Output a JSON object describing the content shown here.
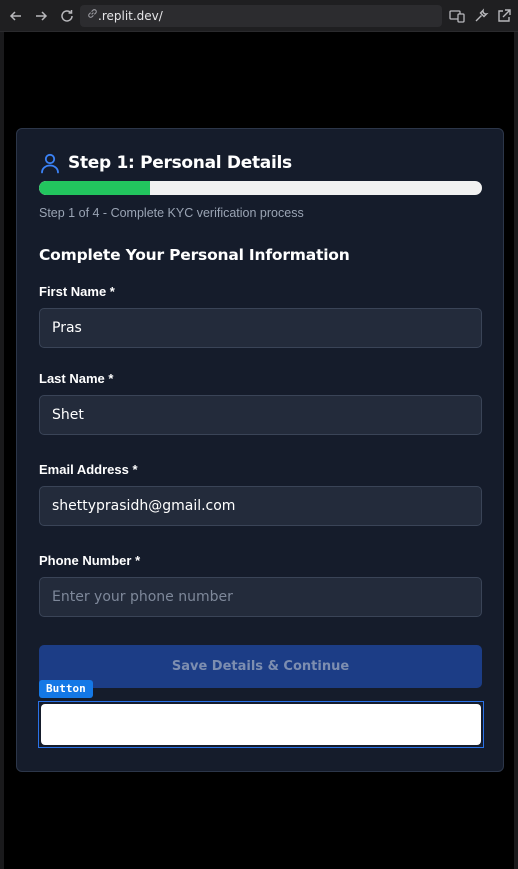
{
  "browser": {
    "url": ".replit.dev/"
  },
  "card": {
    "step_title": "Step 1: Personal Details",
    "progress": 0.25,
    "progress_color": "#22c55e",
    "step_subtitle": "Step 1 of 4 - Complete KYC verification process",
    "section_heading": "Complete Your Personal Information"
  },
  "form": {
    "first_name": {
      "label": "First Name *",
      "value": "Pras"
    },
    "last_name": {
      "label": "Last Name *",
      "value": "Shet"
    },
    "email": {
      "label": "Email Address *",
      "value": "shettyprasidh@gmail.com"
    },
    "phone": {
      "label": "Phone Number *",
      "value": "",
      "placeholder": "Enter your phone number"
    },
    "submit_label": "Save Details & Continue",
    "debug_tag": "Button"
  },
  "colors": {
    "accent": "#3b82f6",
    "button_bg": "#1c3d86"
  }
}
